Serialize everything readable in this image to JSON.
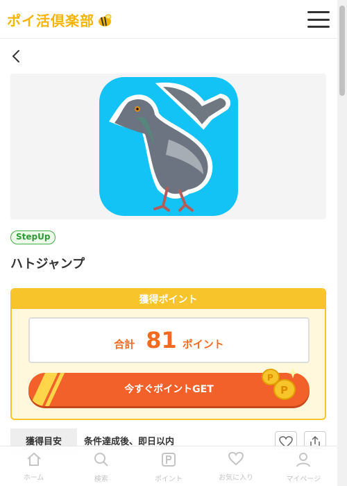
{
  "header": {
    "logo_text": "ポイ活倶楽部",
    "logo_color": "#f4b400"
  },
  "app": {
    "badge": "StepUp",
    "title": "ハトジャンプ"
  },
  "points": {
    "heading": "獲得ポイント",
    "total_label": "合計",
    "total_value": "81",
    "unit": "ポイント",
    "button_label": "今すぐポイントGET",
    "accent": "#f2612a",
    "frame": "#f7c52b"
  },
  "estimate": {
    "label": "獲得目安",
    "text": "条件達成後、即日以内"
  },
  "tabbar": {
    "items": [
      {
        "label": "ホーム",
        "icon": "home-icon"
      },
      {
        "label": "検索",
        "icon": "search-icon"
      },
      {
        "label": "ポイント",
        "icon": "point-icon"
      },
      {
        "label": "お気に入り",
        "icon": "heart-icon"
      },
      {
        "label": "マイページ",
        "icon": "user-icon"
      }
    ]
  }
}
